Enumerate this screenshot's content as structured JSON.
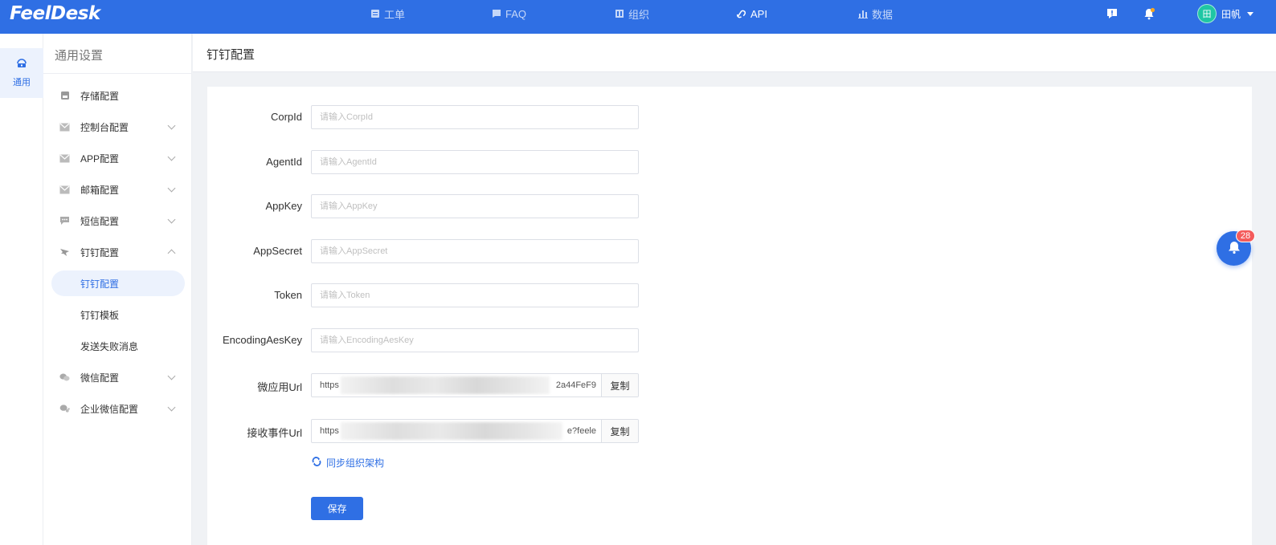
{
  "app": {
    "logo": "FeelDesk"
  },
  "nav": [
    {
      "label": "工单",
      "icon": "ticket-icon"
    },
    {
      "label": "FAQ",
      "icon": "faq-icon"
    },
    {
      "label": "组织",
      "icon": "organization-icon"
    },
    {
      "label": "API",
      "icon": "api-link-icon",
      "active": true
    },
    {
      "label": "数据",
      "icon": "data-chart-icon"
    }
  ],
  "header_icons": [
    "feedback-icon",
    "notification-bell-icon"
  ],
  "user": {
    "avatar_text": "田",
    "name": "田帆"
  },
  "rail": {
    "label": "通用",
    "icon": "general-settings-icon"
  },
  "sidebar": {
    "title": "通用设置",
    "items": [
      {
        "label": "存储配置",
        "icon": "storage-icon"
      },
      {
        "label": "控制台配置",
        "icon": "console-icon",
        "expandable": true
      },
      {
        "label": "APP配置",
        "icon": "app-icon",
        "expandable": true
      },
      {
        "label": "邮箱配置",
        "icon": "mail-icon",
        "expandable": true
      },
      {
        "label": "短信配置",
        "icon": "sms-icon",
        "expandable": true
      },
      {
        "label": "钉钉配置",
        "icon": "dingtalk-icon",
        "expandable": true,
        "expanded": true
      },
      {
        "label": "微信配置",
        "icon": "wechat-icon",
        "expandable": true
      },
      {
        "label": "企业微信配置",
        "icon": "wecom-icon",
        "expandable": true
      }
    ],
    "subitems": [
      {
        "label": "钉钉配置",
        "active": true
      },
      {
        "label": "钉钉模板"
      },
      {
        "label": "发送失败消息"
      }
    ]
  },
  "page": {
    "title": "钉钉配置"
  },
  "form": {
    "fields": [
      {
        "label": "CorpId",
        "placeholder": "请输入CorpId",
        "value": ""
      },
      {
        "label": "AgentId",
        "placeholder": "请输入AgentId",
        "value": ""
      },
      {
        "label": "AppKey",
        "placeholder": "请输入AppKey",
        "value": ""
      },
      {
        "label": "AppSecret",
        "placeholder": "请输入AppSecret",
        "value": ""
      },
      {
        "label": "Token",
        "placeholder": "请输入Token",
        "value": ""
      },
      {
        "label": "EncodingAesKey",
        "placeholder": "请输入EncodingAesKey",
        "value": ""
      }
    ],
    "urls": [
      {
        "label": "微应用Url",
        "prefix": "https",
        "suffix": "2a44FeF9",
        "copy_label": "复制"
      },
      {
        "label": "接收事件Url",
        "prefix": "https",
        "suffix": "e?feele",
        "copy_label": "复制"
      }
    ],
    "sync_label": "同步组织架构",
    "save_label": "保存"
  },
  "float_notifications": {
    "count": "28"
  },
  "colors": {
    "primary": "#2f6fe4",
    "badge": "#f45b5b",
    "avatar": "#1fc6a4"
  }
}
